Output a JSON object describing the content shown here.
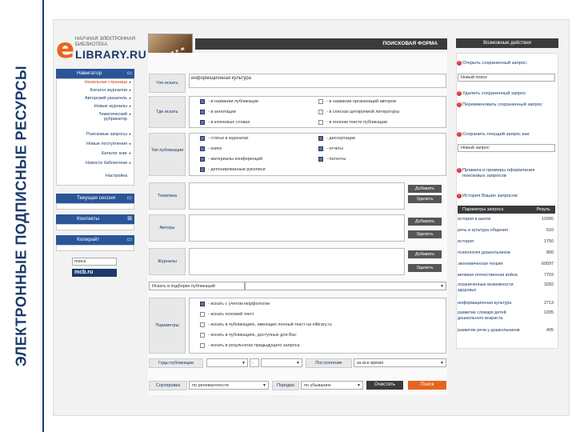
{
  "side_title": "ЭЛЕКТРОННЫЕ ПОДПИСНЫЕ РЕСУРСЫ",
  "logo": {
    "letter": "e",
    "tagline": "НАУЧНАЯ ЭЛЕКТРОННАЯ БИБЛИОТЕКА",
    "name": "LIBRARY.RU"
  },
  "nav": {
    "navigator_label": "Навигатор",
    "items": [
      {
        "label": "Начальная страница",
        "active": true
      },
      {
        "label": "Каталог журналов"
      },
      {
        "label": "Авторский указатель"
      },
      {
        "label": "Новые журналы"
      },
      {
        "label": "Тематический рубрикатор"
      },
      {
        "label": "Поисковые запросы"
      },
      {
        "label": "Новые поступления"
      },
      {
        "label": "Каталог книг"
      },
      {
        "label": "Новости библиотеки"
      },
      {
        "label": "Настройка"
      }
    ],
    "session_label": "Текущая сессия",
    "contacts_label": "Контакты",
    "copyright_label": "Копирайт",
    "search_value": "поиск",
    "mcb_label": "mcb.ru"
  },
  "form": {
    "header": "ПОИСКОВАЯ ФОРМА",
    "what_label": "Что искать",
    "what_value": "информационная культура",
    "where_label": "Где искать",
    "where_options": [
      {
        "label": "- в названии публикации",
        "checked": true
      },
      {
        "label": "- в названии организаций авторов",
        "checked": false
      },
      {
        "label": "- в аннотации",
        "checked": true
      },
      {
        "label": "- в списках цитируемой литературы",
        "checked": false
      },
      {
        "label": "- в ключевых словах",
        "checked": true
      },
      {
        "label": "- в полном тексте публикации",
        "checked": false
      }
    ],
    "type_label": "Тип публикации",
    "type_options": [
      {
        "label": "- статьи в журналах",
        "checked": true
      },
      {
        "label": "- диссертации",
        "checked": true
      },
      {
        "label": "- книги",
        "checked": true
      },
      {
        "label": "- отчеты",
        "checked": true
      },
      {
        "label": "- материалы конференций",
        "checked": true
      },
      {
        "label": "- патенты",
        "checked": true
      },
      {
        "label": "- депонированные рукописи",
        "checked": true
      }
    ],
    "topic_label": "Тематика",
    "authors_label": "Авторы",
    "journals_label": "Журналы",
    "add_label": "Добавить",
    "delete_label": "Удалить",
    "source_select": "Искать в подборке публикаций",
    "params_label": "Параметры",
    "params_options": [
      {
        "label": "- искать с учетом морфологии",
        "checked": true
      },
      {
        "label": "- искать похожий текст",
        "checked": false
      },
      {
        "label": "- искать в публикациях, имеющих полный текст на elibrary.ru",
        "checked": false
      },
      {
        "label": "- искать в публикациях, доступных для Вас",
        "checked": false
      },
      {
        "label": "- искать в результатах предыдущего запроса",
        "checked": false
      }
    ],
    "years_label": "Годы публикации",
    "years_dash": "-",
    "arrival_label": "Поступление",
    "arrival_value": "за все время",
    "sort_label": "Сортировка",
    "sort_value": "по релевантности",
    "order_label": "Порядок",
    "order_value": "по убыванию",
    "clear_label": "Очистить",
    "search_label": "Поиск"
  },
  "right": {
    "header": "Возможные действия",
    "open_saved": "Открыть сохраненный запрос:",
    "new_search": "Новый поиск",
    "delete_saved": "Удалить сохраненный запрос",
    "rename_saved": "Переименовать сохраненный запрос",
    "save_current": "Сохранить текущий запрос как:",
    "new_query": "Новый запрос",
    "rules": "Правила и примеры оформления поисковых запросов",
    "history": "История Ваших запросов:",
    "hist_col1": "Параметры запроса",
    "hist_col2": "Резуль",
    "history_rows": [
      {
        "q": "история в школе",
        "n": "10395"
      },
      {
        "q": "речь и культура общения",
        "n": "510"
      },
      {
        "q": "история",
        "n": "1750"
      },
      {
        "q": "психология дошкольников",
        "n": "860"
      },
      {
        "q": "экономическая теория",
        "n": "60597"
      },
      {
        "q": "великая отечественная война",
        "n": "7703"
      },
      {
        "q": "ограниченные возможности здоровья",
        "n": "3282"
      },
      {
        "q": "информационная культура",
        "n": "2713"
      },
      {
        "q": "развитие словаря детей дошкольного возраста",
        "n": "1005"
      },
      {
        "q": "развитие речи у дошкольников",
        "n": "405"
      }
    ]
  }
}
